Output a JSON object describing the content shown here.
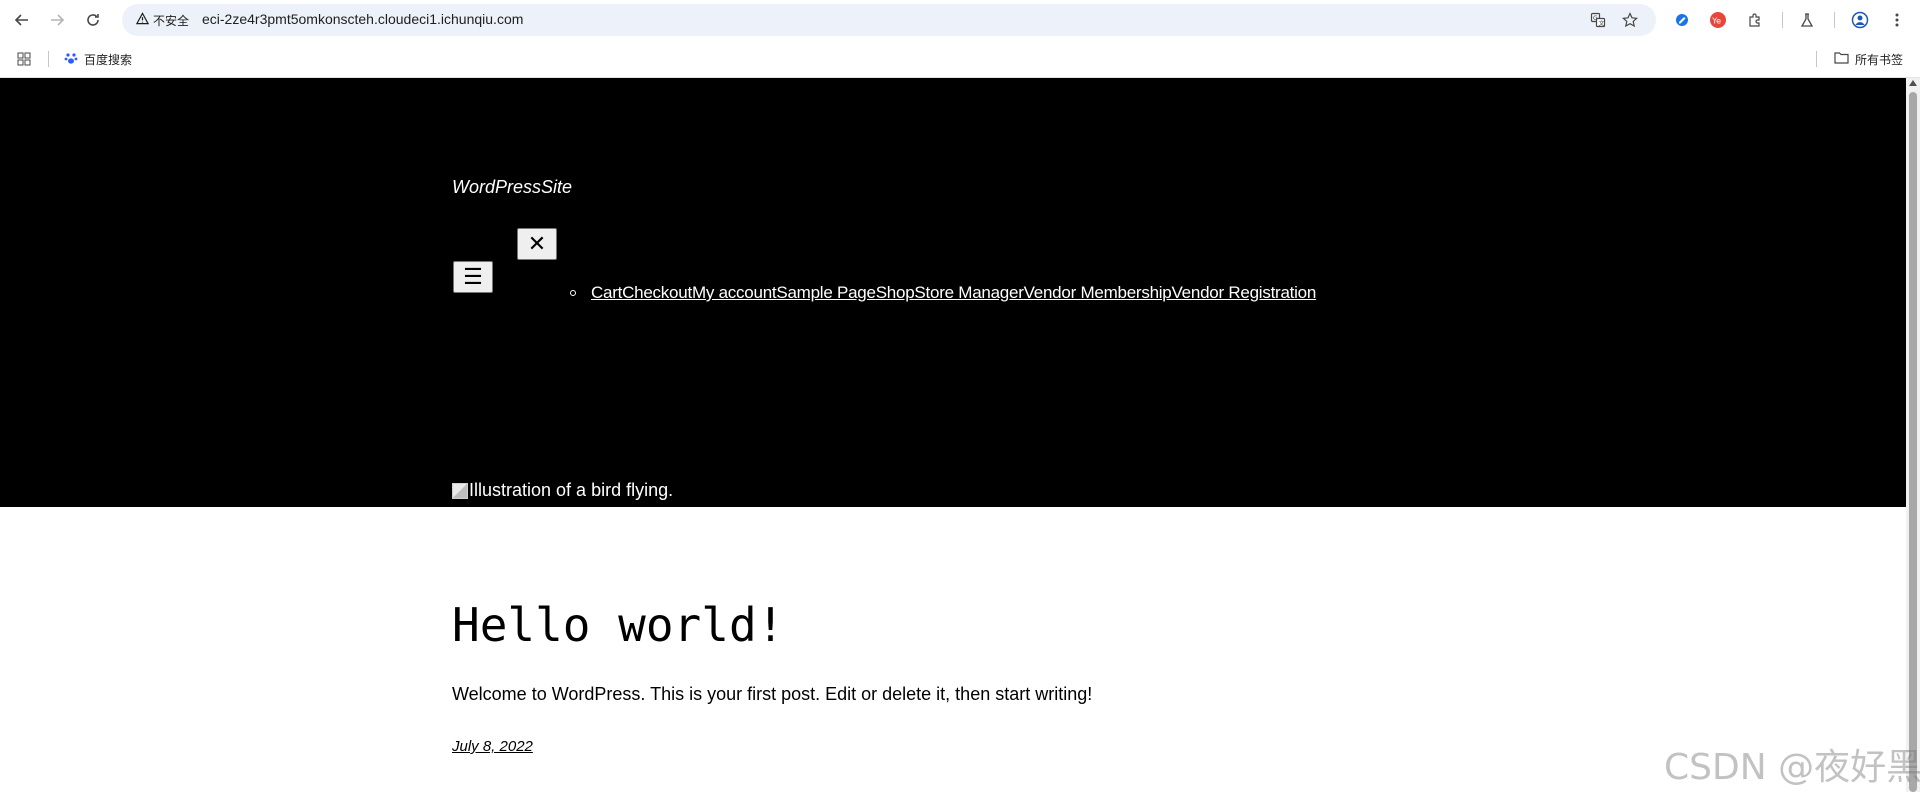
{
  "browser": {
    "security_label": "不安全",
    "url": "eci-2ze4r3pmt5omkonscteh.cloudeci1.ichunqiu.com",
    "bookmarks": [
      {
        "label": "百度搜索"
      }
    ],
    "all_bookmarks_label": "所有书签",
    "extension_badge": "Ye"
  },
  "site": {
    "title": "WordPressSite",
    "menu_open_glyph": "☰",
    "menu_close_glyph": "✕",
    "nav": [
      "Cart",
      "Checkout",
      "My account",
      "Sample Page",
      "Shop",
      "Store Manager",
      "Vendor Membership",
      "Vendor Registration"
    ],
    "hero_alt": "Illustration of a bird flying."
  },
  "post": {
    "title": "Hello world!",
    "excerpt": "Welcome to WordPress. This is your first post. Edit or delete it, then start writing!",
    "date": "July 8, 2022"
  },
  "watermark": "CSDN @夜好黑"
}
